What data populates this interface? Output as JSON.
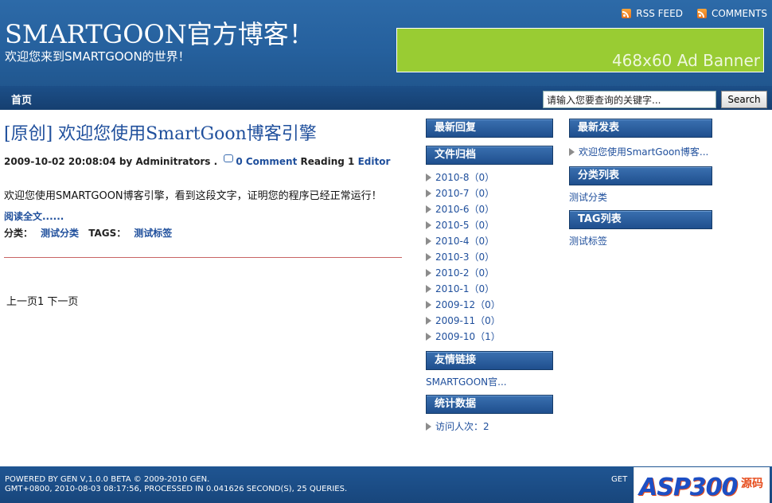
{
  "header": {
    "title": "SMARTGOON官方博客！",
    "subtitle": "欢迎您来到SMARTGOON的世界！",
    "rss_feed": "RSS FEED",
    "comments": "COMMENTS",
    "ad_banner": "468x60 Ad Banner"
  },
  "nav": {
    "home": "首页",
    "search_value": "请输入您要查询的关键字...",
    "search_button": "Search"
  },
  "post": {
    "title": "[原创] 欢迎您使用SmartGoon博客引擎",
    "date": "2009-10-02 20:08:04",
    "by": "by",
    "author": "Adminitrators",
    "dot": ".",
    "comment_link": "0 Comment",
    "reading_label": "Reading",
    "reading_count": "1",
    "editor_link": "Editor",
    "body": "欢迎您使用SMARTGOON博客引擎，看到这段文字，证明您的程序已经正常运行！",
    "read_more": "阅读全文......",
    "category_label": "分类：",
    "category": "测试分类",
    "tags_label": "TAGS：",
    "tag": "测试标签"
  },
  "pager": "上一页1 下一页",
  "sidebar_mid": {
    "recent_replies": "最新回复",
    "archive_title": "文件归档",
    "archive": [
      "2010-8（0）",
      "2010-7（0）",
      "2010-6（0）",
      "2010-5（0）",
      "2010-4（0）",
      "2010-3（0）",
      "2010-2（0）",
      "2010-1（0）",
      "2009-12（0）",
      "2009-11（0）",
      "2009-10（1）"
    ],
    "links_title": "友情链接",
    "link": "SMARTGOON官...",
    "stats_title": "统计数据",
    "stats_label": "访问人次：",
    "stats_value": "2"
  },
  "sidebar_right": {
    "recent_posts": "最新发表",
    "recent_post_item": "欢迎您使用SmartGoon博客...",
    "categories_title": "分类列表",
    "category_item": "测试分类",
    "tags_title": "TAG列表",
    "tag_item": "测试标签"
  },
  "footer": {
    "line1": "POWERED BY GEN V,1.0.0 BETA © 2009-2010 GEN.",
    "line2": "GMT+0800, 2010-08-03 08:17:56, PROCESSED IN 0.041626 SECOND(S), 25 QUERIES.",
    "get": "GET"
  },
  "watermark": {
    "main": "ASP300",
    "sub": "源码"
  },
  "colors": {
    "header_blue": "#2d6aa8",
    "nav_blue": "#1c4f88",
    "ad_green": "#99cc33",
    "link_blue": "#1f4f9c",
    "divider_red": "#c86464"
  }
}
